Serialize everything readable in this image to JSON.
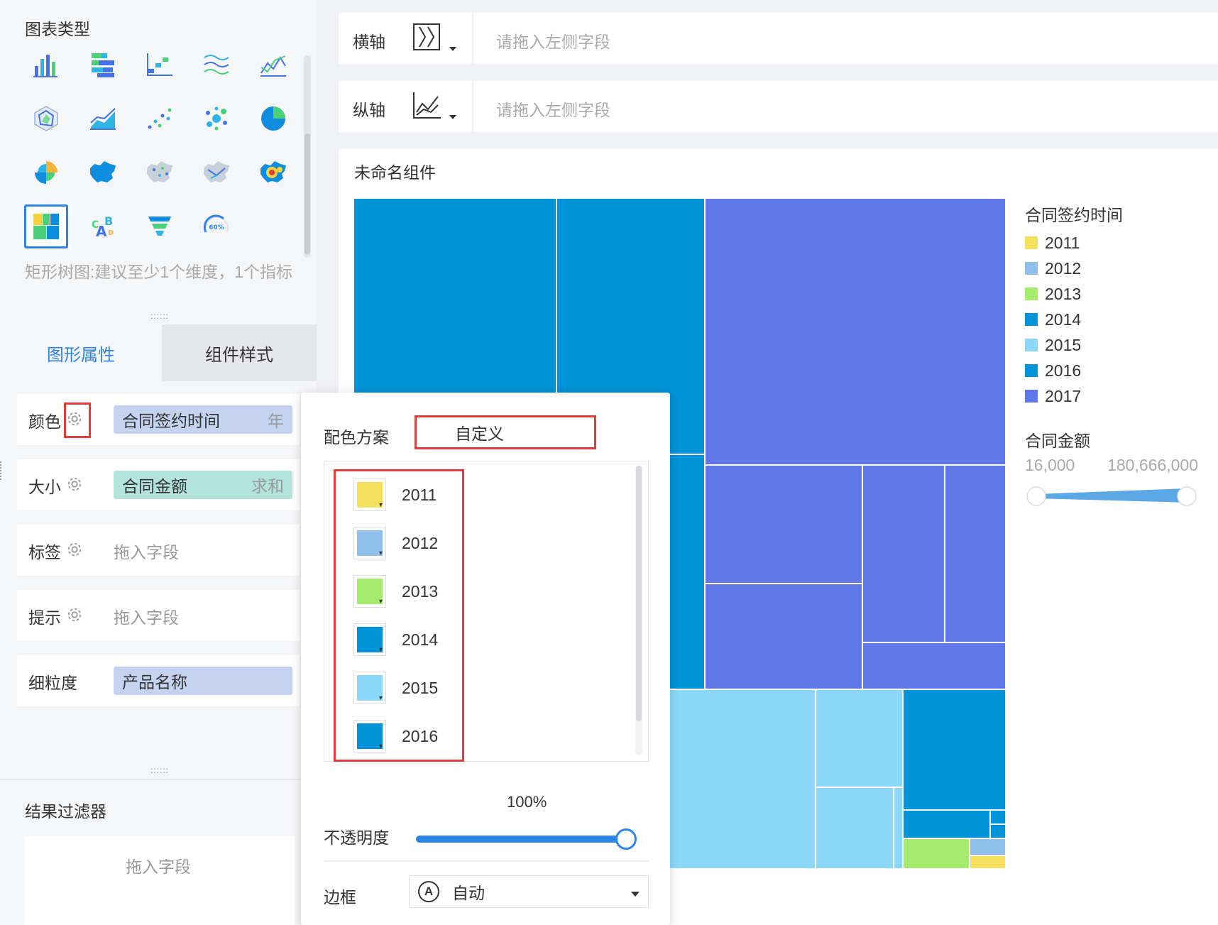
{
  "chart_types": {
    "title": "图表类型",
    "icons": [
      "bar-chart-icon",
      "stacked-bar-icon",
      "step-chart-icon",
      "range-area-icon",
      "line-chart-icon",
      "radar-chart-icon",
      "area-chart-icon",
      "scatter-chart-icon",
      "bubble-chart-icon",
      "pie-chart-icon",
      "rose-chart-icon",
      "china-map-icon",
      "point-map-icon",
      "flow-map-icon",
      "heat-map-icon",
      "treemap-icon",
      "word-cloud-icon",
      "funnel-icon",
      "gauge-icon"
    ],
    "gauge_label": "60%",
    "hint": "矩形树图:建议至少1个维度，1个指标"
  },
  "tabs": {
    "graph_props": "图形属性",
    "component_style": "组件样式"
  },
  "properties": {
    "color": {
      "label": "颜色",
      "field": "合同签约时间",
      "suffix": "年"
    },
    "size": {
      "label": "大小",
      "field": "合同金额",
      "suffix": "求和"
    },
    "tag": {
      "label": "标签",
      "placeholder": "拖入字段"
    },
    "tooltip": {
      "label": "提示",
      "placeholder": "拖入字段"
    },
    "granularity": {
      "label": "细粒度",
      "field": "产品名称"
    }
  },
  "filter": {
    "title": "结果过滤器",
    "placeholder": "拖入字段"
  },
  "axes": {
    "x": {
      "label": "横轴",
      "placeholder": "请拖入左侧字段"
    },
    "y": {
      "label": "纵轴",
      "placeholder": "请拖入左侧字段"
    }
  },
  "component": {
    "title": "未命名组件"
  },
  "legend": {
    "color_title": "合同签约时间",
    "items": [
      {
        "label": "2011",
        "color": "#f5e05e"
      },
      {
        "label": "2012",
        "color": "#8ec0ea"
      },
      {
        "label": "2013",
        "color": "#a5ec6e"
      },
      {
        "label": "2014",
        "color": "#0193d7"
      },
      {
        "label": "2015",
        "color": "#8cd8fa"
      },
      {
        "label": "2016",
        "color": "#0193d7"
      },
      {
        "label": "2017",
        "color": "#6078e7"
      }
    ],
    "size_title": "合同金额",
    "size_min": "16,000",
    "size_max": "180,666,000"
  },
  "popup": {
    "scheme_label": "配色方案",
    "scheme_value": "自定义",
    "colors": [
      {
        "year": "2011",
        "color": "#f5e05e"
      },
      {
        "year": "2012",
        "color": "#8ec0ea"
      },
      {
        "year": "2013",
        "color": "#a5ec6e"
      },
      {
        "year": "2014",
        "color": "#0193d7"
      },
      {
        "year": "2015",
        "color": "#8cd8fa"
      },
      {
        "year": "2016",
        "color": "#0193d7"
      }
    ],
    "opacity_label": "不透明度",
    "opacity_value": "100%",
    "opacity_fraction": 1.0,
    "border_label": "边框",
    "border_icon": "A",
    "border_value": "自动"
  },
  "colors": {
    "accent": "#2f84e8",
    "highlight_red": "#e23b3b",
    "pill_blue": "#c4d3f0",
    "pill_green": "#b2e4dc"
  }
}
